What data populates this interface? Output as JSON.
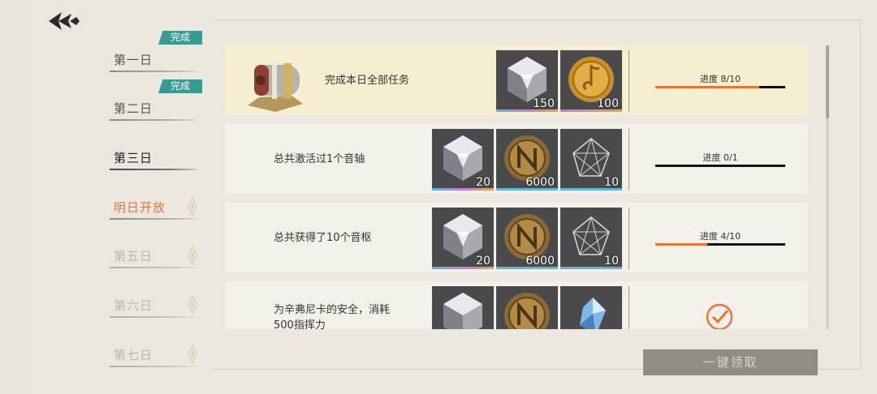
{
  "days": [
    {
      "label": "第一日",
      "badge": "完成",
      "state": "done"
    },
    {
      "label": "第二日",
      "badge": "完成",
      "state": "done"
    },
    {
      "label": "第三日",
      "badge": "",
      "state": "current"
    },
    {
      "label": "明日开放",
      "badge": "",
      "state": "next"
    },
    {
      "label": "第五日",
      "badge": "",
      "state": "locked"
    },
    {
      "label": "第六日",
      "badge": "",
      "state": "locked"
    },
    {
      "label": "第七日",
      "badge": "",
      "state": "locked"
    }
  ],
  "colors": {
    "accent": "#e8743a",
    "badge": "#3a9991",
    "current": "#222222",
    "next": "#e8743a",
    "locked": "#bcb6ab",
    "done": "#555555"
  },
  "tasks": [
    {
      "text": "完成本日全部任务",
      "rewards": [
        {
          "icon": "crystal-icon",
          "qty": "150"
        },
        {
          "icon": "gold-music-coin-icon",
          "qty": "100"
        }
      ],
      "progress_text": "进度 8/10",
      "progress": 0.8
    },
    {
      "text": "总共激活过1个音轴",
      "rewards": [
        {
          "icon": "crystal-icon",
          "qty": "20"
        },
        {
          "icon": "bronze-coin-icon",
          "qty": "6000"
        },
        {
          "icon": "wireframe-crystal-icon",
          "qty": "10"
        }
      ],
      "progress_text": "进度 0/1",
      "progress": 0
    },
    {
      "text": "总共获得了10个音枢",
      "rewards": [
        {
          "icon": "crystal-icon",
          "qty": "20"
        },
        {
          "icon": "bronze-coin-icon",
          "qty": "6000"
        },
        {
          "icon": "wireframe-crystal-icon",
          "qty": "10"
        }
      ],
      "progress_text": "进度 4/10",
      "progress": 0.4
    },
    {
      "text": "为辛弗尼卡的安全，消耗500指挥力",
      "rewards": [
        {
          "icon": "crystal-icon",
          "qty": ""
        },
        {
          "icon": "bronze-coin-icon",
          "qty": ""
        },
        {
          "icon": "blue-shard-icon",
          "qty": ""
        }
      ],
      "progress_text": "",
      "progress": 1,
      "completed": true
    }
  ],
  "claim_all_label": "一键领取"
}
